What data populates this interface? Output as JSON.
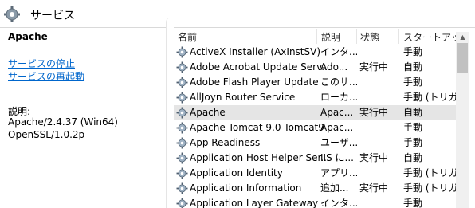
{
  "window": {
    "title": "サービス",
    "icon": "services-gear-icon"
  },
  "left_pane": {
    "service_name": "Apache",
    "links": {
      "stop": "サービスの停止",
      "restart": "サービスの再起動"
    },
    "description_label": "説明:",
    "description_lines": [
      "Apache/2.4.37 (Win64)",
      "OpenSSL/1.0.2p"
    ]
  },
  "list": {
    "sort_indicator": "^",
    "columns": {
      "name": "名前",
      "description": "説明",
      "status": "状態",
      "startup": "スタートアップの"
    },
    "rows": [
      {
        "name": "ActiveX Installer (AxInstSV)",
        "description": "インタ...",
        "status": "",
        "startup": "手動",
        "selected": false
      },
      {
        "name": "Adobe Acrobat Update Serv...",
        "description": "Ado...",
        "status": "実行中",
        "startup": "自動",
        "selected": false
      },
      {
        "name": "Adobe Flash Player Update ...",
        "description": "このサ...",
        "status": "",
        "startup": "手動",
        "selected": false
      },
      {
        "name": "AllJoyn Router Service",
        "description": "ローカ...",
        "status": "",
        "startup": "手動 (トリガー",
        "selected": false
      },
      {
        "name": "Apache",
        "description": "Apac...",
        "status": "実行中",
        "startup": "自動",
        "selected": true
      },
      {
        "name": "Apache Tomcat 9.0 Tomcat9",
        "description": "Apac...",
        "status": "",
        "startup": "手動",
        "selected": false
      },
      {
        "name": "App Readiness",
        "description": "ユーザ...",
        "status": "",
        "startup": "手動",
        "selected": false
      },
      {
        "name": "Application Host Helper Ser...",
        "description": "IIS に...",
        "status": "実行中",
        "startup": "自動",
        "selected": false
      },
      {
        "name": "Application Identity",
        "description": "アプリ...",
        "status": "",
        "startup": "手動 (トリガー",
        "selected": false
      },
      {
        "name": "Application Information",
        "description": "追加...",
        "status": "実行中",
        "startup": "手動 (トリガー",
        "selected": false
      },
      {
        "name": "Application Layer Gateway ...",
        "description": "インタ...",
        "status": "",
        "startup": "手動",
        "selected": false
      }
    ]
  },
  "colors": {
    "link": "#0066cc",
    "selected_row": "#e5e5e5",
    "scrollbar_thumb": "#c1c1c1"
  }
}
